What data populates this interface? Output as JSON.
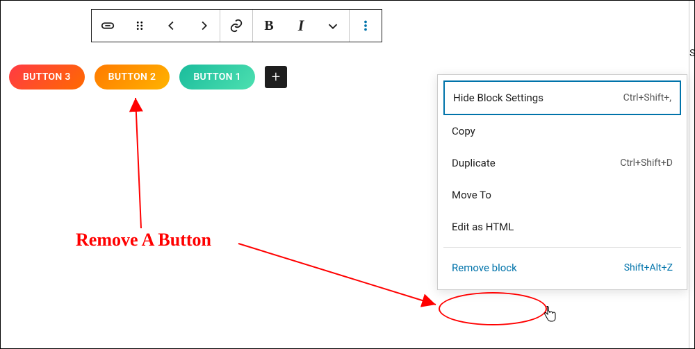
{
  "toolbar": {
    "block": "buttons-block",
    "drag": "drag-handle",
    "prev": "◀",
    "next": "▶",
    "link": "link",
    "bold": "B",
    "italic": "I",
    "more": "more-formatting",
    "options": "⋮"
  },
  "buttons": [
    {
      "label": "BUTTON 3",
      "style": "pill3"
    },
    {
      "label": "BUTTON 2",
      "style": "pill2"
    },
    {
      "label": "BUTTON 1",
      "style": "pill1"
    }
  ],
  "add_label": "+",
  "menu": {
    "items": [
      {
        "label": "Hide Block Settings",
        "shortcut": "Ctrl+Shift+,",
        "highlight": true
      },
      {
        "label": "Copy",
        "shortcut": ""
      },
      {
        "label": "Duplicate",
        "shortcut": "Ctrl+Shift+D"
      },
      {
        "label": "Move To",
        "shortcut": ""
      },
      {
        "label": "Edit as HTML",
        "shortcut": ""
      }
    ],
    "remove": {
      "label": "Remove block",
      "shortcut": "Shift+Alt+Z"
    }
  },
  "annotation": "Remove A Button",
  "side_text": "St",
  "colors": {
    "accent": "#0073aa",
    "annotation": "#ff0000"
  }
}
